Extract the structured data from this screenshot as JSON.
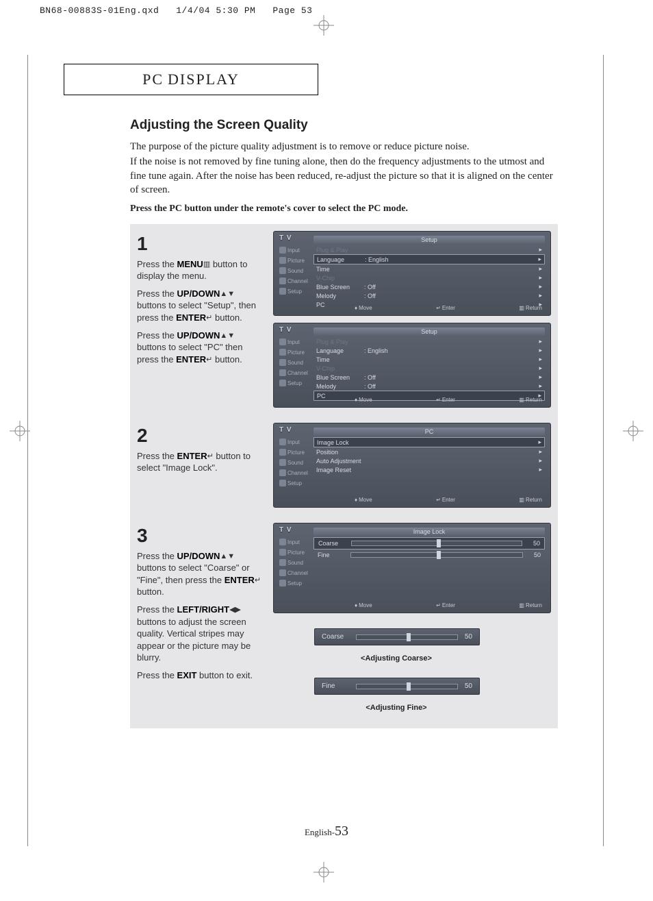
{
  "header": {
    "filename": "BN68-00883S-01Eng.qxd",
    "date": "1/4/04 5:30 PM",
    "pageinfo": "Page 53"
  },
  "chapter": {
    "pc": "PC",
    "display": "DISPLAY"
  },
  "section": {
    "title": "Adjusting the Screen Quality",
    "intro": [
      "The purpose of the picture quality adjustment is to remove or reduce picture noise.",
      "If the noise is not removed by fine tuning alone, then do the frequency adjustments to the utmost and fine tune again. After the noise has been reduced, re-adjust the picture so that it is aligned on the center of screen."
    ],
    "pcline": "Press the PC button under the remote's cover to select the PC mode."
  },
  "buttons": {
    "menu": "MENU",
    "updown": "UP/DOWN",
    "enter": "ENTER",
    "leftright": "LEFT/RIGHT",
    "exit": "EXIT"
  },
  "steps": {
    "s1": {
      "num": "1",
      "p1a": "Press the ",
      "p1b": " button to display the menu.",
      "p2a": "Press the ",
      "p2b": " buttons to select \"Setup\", then press the ",
      "p2c": " button.",
      "p3a": "Press the ",
      "p3b": " buttons to select \"PC\" then press the ",
      "p3c": " button."
    },
    "s2": {
      "num": "2",
      "p1a": "Press the ",
      "p1b": " button to select \"Image Lock\"."
    },
    "s3": {
      "num": "3",
      "p1a": "Press the ",
      "p1b": " buttons to select \"Coarse\" or \"Fine\", then press the ",
      "p1c": " button.",
      "p2a": "Press the ",
      "p2b": " buttons to adjust the screen quality. Vertical stripes may appear or the picture may be blurry.",
      "p3a": "Press the ",
      "p3b": " button to exit."
    }
  },
  "osd": {
    "tv": "T V",
    "side": {
      "input": "Input",
      "picture": "Picture",
      "sound": "Sound",
      "channel": "Channel",
      "setup": "Setup"
    },
    "setup": {
      "title": "Setup",
      "plugplay": "Plug & Play",
      "language": "Language",
      "language_v": ": English",
      "time": "Time",
      "vchip": "V-Chip",
      "bluescreen": "Blue Screen",
      "bluescreen_v": ": Off",
      "melody": "Melody",
      "melody_v": ": Off",
      "pc": "PC"
    },
    "pc": {
      "title": "PC",
      "imagelock": "Image Lock",
      "position": "Position",
      "auto": "Auto Adjustment",
      "reset": "Image Reset"
    },
    "imagelock": {
      "title": "Image Lock",
      "coarse": "Coarse",
      "coarse_v": "50",
      "fine": "Fine",
      "fine_v": "50"
    },
    "foot": {
      "move": "Move",
      "enter": "Enter",
      "return": "Return"
    },
    "adjcoarse": "<Adjusting Coarse>",
    "adjfine": "<Adjusting Fine>"
  },
  "pagenum": {
    "lang": "English-",
    "num": "53"
  }
}
